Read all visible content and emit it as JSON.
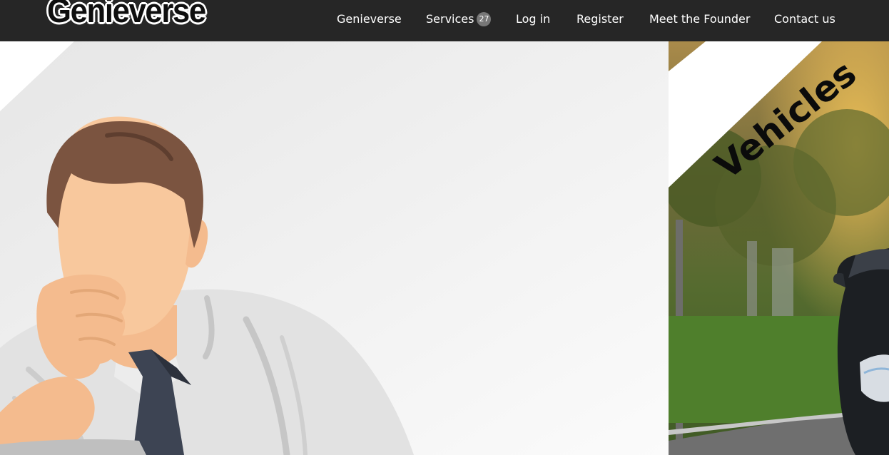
{
  "brand": {
    "logo_text": "Genieverse"
  },
  "nav": {
    "items": [
      {
        "label": "Genieverse"
      },
      {
        "label": "Services",
        "badge": "27"
      },
      {
        "label": "Log in"
      },
      {
        "label": "Register"
      },
      {
        "label": "Meet the Founder"
      },
      {
        "label": "Contact us"
      }
    ]
  },
  "hero": {
    "slides": [
      {
        "image": "thinking-man-illustration"
      },
      {
        "image": "car-photo",
        "ribbon_text": "Vehicles"
      }
    ]
  },
  "colors": {
    "navbar_bg": "#262626",
    "nav_text": "#ffffff",
    "badge_bg": "#777777",
    "ribbon_bg": "#ffffff"
  }
}
